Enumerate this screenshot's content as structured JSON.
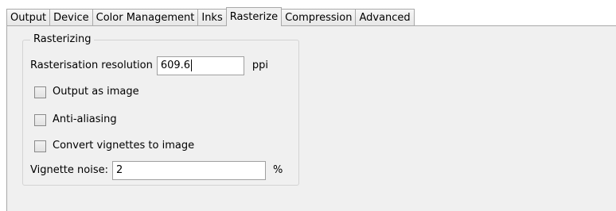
{
  "tabs": [
    {
      "label": "Output",
      "active": false
    },
    {
      "label": "Device",
      "active": false
    },
    {
      "label": "Color Management",
      "active": false
    },
    {
      "label": "Inks",
      "active": false
    },
    {
      "label": "Rasterize",
      "active": true
    },
    {
      "label": "Compression",
      "active": false
    },
    {
      "label": "Advanced",
      "active": false
    }
  ],
  "rasterizing": {
    "group_title": "Rasterizing",
    "resolution_label": "Rasterisation resolution",
    "resolution_value": "609.6",
    "resolution_unit": "ppi",
    "output_as_image_label": "Output as image",
    "output_as_image_checked": false,
    "anti_aliasing_label": "Anti-aliasing",
    "anti_aliasing_checked": false,
    "convert_vignettes_label": "Convert vignettes to image",
    "convert_vignettes_checked": false,
    "vignette_noise_label": "Vignette noise:",
    "vignette_noise_value": "2",
    "vignette_noise_unit": "%"
  }
}
